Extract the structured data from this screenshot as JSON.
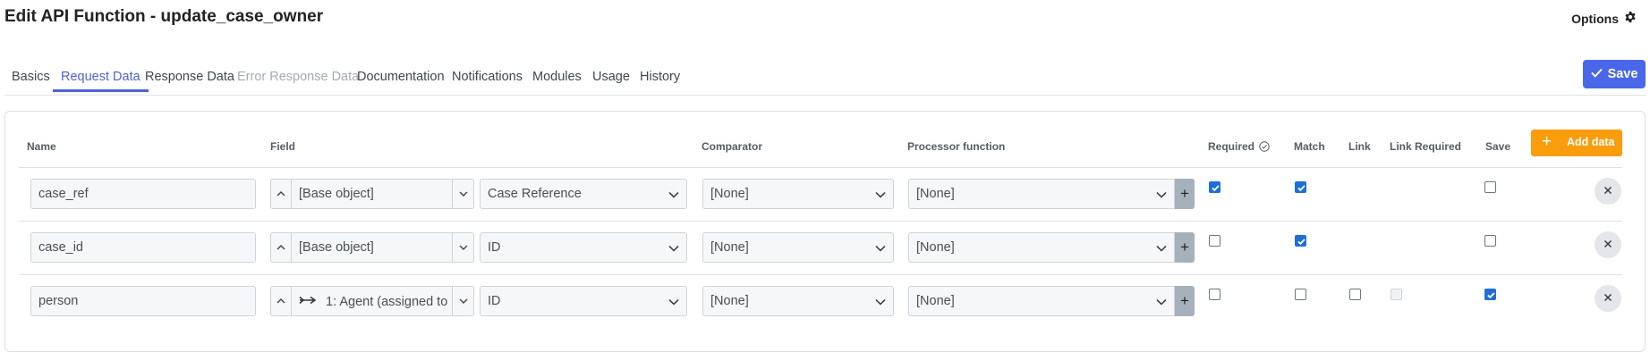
{
  "page": {
    "title": "Edit API Function - update_case_owner"
  },
  "header": {
    "options_label": "Options",
    "options_icon": "gear-icon"
  },
  "tabs": [
    {
      "label": "Basics",
      "state": "normal"
    },
    {
      "label": "Request Data",
      "state": "active"
    },
    {
      "label": "Response Data",
      "state": "normal"
    },
    {
      "label": "Error Response Data",
      "state": "disabled"
    },
    {
      "label": "Documentation",
      "state": "normal"
    },
    {
      "label": "Notifications",
      "state": "normal"
    },
    {
      "label": "Modules",
      "state": "normal"
    },
    {
      "label": "Usage",
      "state": "normal"
    },
    {
      "label": "History",
      "state": "normal"
    }
  ],
  "toolbar": {
    "save_label": "Save",
    "save_icon": "check-icon"
  },
  "table": {
    "headers": {
      "name": "Name",
      "field": "Field",
      "comparator": "Comparator",
      "processor": "Processor function",
      "required": "Required",
      "match": "Match",
      "link": "Link",
      "link_required": "Link Required",
      "save": "Save"
    },
    "add_label": "Add data",
    "rows": [
      {
        "name": "case_ref",
        "path": "[Base object]",
        "path_icon": "",
        "field": "Case Reference",
        "comparator": "[None]",
        "processor": "[None]",
        "required": true,
        "match": true,
        "link": null,
        "link_required": null,
        "save": false
      },
      {
        "name": "case_id",
        "path": "[Base object]",
        "path_icon": "",
        "field": "ID",
        "comparator": "[None]",
        "processor": "[None]",
        "required": false,
        "match": true,
        "link": null,
        "link_required": null,
        "save": false
      },
      {
        "name": "person",
        "path": "1: Agent (assigned to",
        "path_icon": "relation-arrow-icon",
        "field": "ID",
        "comparator": "[None]",
        "processor": "[None]",
        "required": false,
        "match": false,
        "link": false,
        "link_required": "disabled",
        "save": true
      }
    ]
  },
  "colors": {
    "accent": "#4a67ea",
    "tab_active": "#4f63d6",
    "add_button": "#f99d0c",
    "checkbox_checked": "#1f6fd6"
  }
}
